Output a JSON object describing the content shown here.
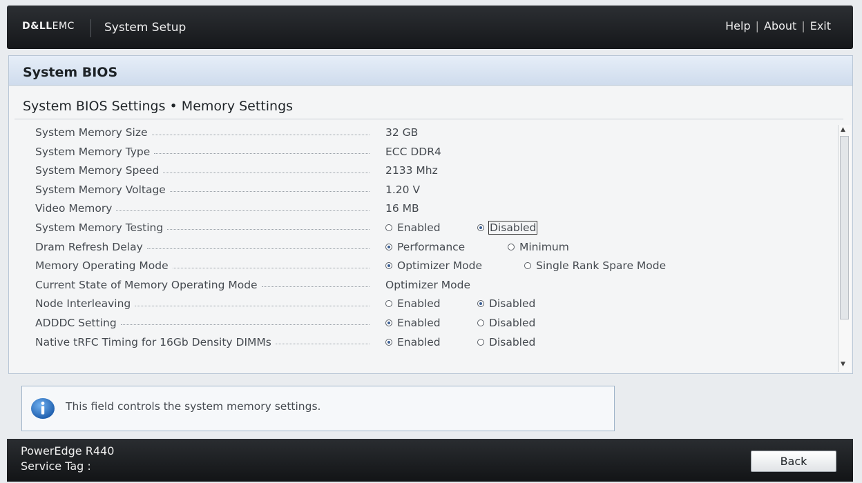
{
  "header": {
    "logo_bold": "D&LL",
    "logo_light": "EMC",
    "app_title": "System Setup",
    "links": [
      "Help",
      "About",
      "Exit"
    ]
  },
  "panel": {
    "title": "System BIOS",
    "breadcrumb": "System BIOS Settings • Memory Settings"
  },
  "settings": [
    {
      "label": "System Memory Size",
      "value": "32 GB"
    },
    {
      "label": "System Memory Type",
      "value": "ECC DDR4"
    },
    {
      "label": "System Memory Speed",
      "value": "2133 Mhz"
    },
    {
      "label": "System Memory Voltage",
      "value": "1.20 V"
    },
    {
      "label": "Video Memory",
      "value": "16 MB"
    },
    {
      "label": "System Memory Testing",
      "options": [
        "Enabled",
        "Disabled"
      ],
      "selected": 1
    },
    {
      "label": "Dram Refresh Delay",
      "options": [
        "Performance",
        "Minimum"
      ],
      "selected": 0
    },
    {
      "label": "Memory Operating Mode",
      "options": [
        "Optimizer Mode",
        "Single Rank Spare Mode"
      ],
      "selected": 0
    },
    {
      "label": "Current State of Memory Operating Mode",
      "value": "Optimizer Mode"
    },
    {
      "label": "Node Interleaving",
      "options": [
        "Enabled",
        "Disabled"
      ],
      "selected": 1
    },
    {
      "label": "ADDDC Setting",
      "options": [
        "Enabled",
        "Disabled"
      ],
      "selected": 0
    },
    {
      "label": "Native tRFC Timing for 16Gb Density DIMMs",
      "options": [
        "Enabled",
        "Disabled"
      ],
      "selected": 0
    }
  ],
  "info": {
    "message": "This field controls the system memory settings.",
    "icon": "info-icon"
  },
  "footer": {
    "model": "PowerEdge R440",
    "service_tag_label": "Service Tag :",
    "back_label": "Back"
  },
  "colors": {
    "header_bg": "#1d1f22",
    "panel_header": "#d6e2f0",
    "radio_selected": "#3b5f94",
    "info_icon": "#2f6fc0"
  }
}
